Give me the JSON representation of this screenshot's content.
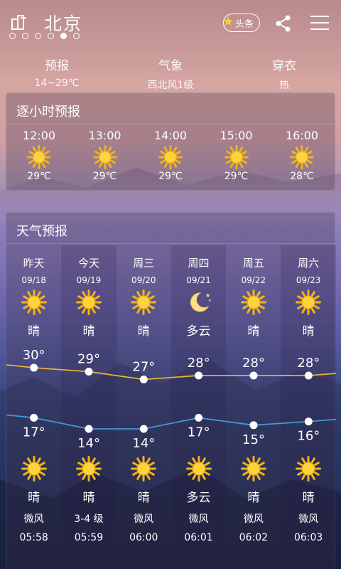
{
  "header": {
    "city": "北京",
    "news_label": "头条",
    "page_dots": 6,
    "active_dot": 4
  },
  "summary": [
    {
      "title": "预报",
      "value": "14~29℃"
    },
    {
      "title": "气象",
      "value": "西北风1级"
    },
    {
      "title": "穿衣",
      "value": "热"
    }
  ],
  "hourly": {
    "title": "逐小时预报",
    "items": [
      {
        "time": "12:00",
        "icon": "sun-icon",
        "temp": "29℃"
      },
      {
        "time": "13:00",
        "icon": "sun-icon",
        "temp": "29℃"
      },
      {
        "time": "14:00",
        "icon": "sun-icon",
        "temp": "29℃"
      },
      {
        "time": "15:00",
        "icon": "sun-icon",
        "temp": "29℃"
      },
      {
        "time": "16:00",
        "icon": "sun-icon",
        "temp": "28℃"
      }
    ]
  },
  "forecast": {
    "title": "天气预报",
    "days": [
      {
        "name": "昨天",
        "date": "09/18",
        "day_icon": "sun-icon",
        "day_cond": "晴",
        "high": 30,
        "low": 17,
        "night_icon": "sun-icon",
        "night_cond": "晴",
        "wind": "微风",
        "sunrise": "05:58"
      },
      {
        "name": "今天",
        "date": "09/19",
        "day_icon": "sun-icon",
        "day_cond": "晴",
        "high": 29,
        "low": 14,
        "night_icon": "sun-icon",
        "night_cond": "晴",
        "wind": "3-4 级",
        "sunrise": "05:59"
      },
      {
        "name": "周三",
        "date": "09/20",
        "day_icon": "sun-icon",
        "day_cond": "晴",
        "high": 27,
        "low": 14,
        "night_icon": "sun-icon",
        "night_cond": "晴",
        "wind": "微风",
        "sunrise": "06:00"
      },
      {
        "name": "周四",
        "date": "09/21",
        "day_icon": "moon-icon",
        "day_cond": "多云",
        "high": 28,
        "low": 17,
        "night_icon": "sun-icon",
        "night_cond": "多云",
        "wind": "微风",
        "sunrise": "06:01"
      },
      {
        "name": "周五",
        "date": "09/22",
        "day_icon": "sun-icon",
        "day_cond": "晴",
        "high": 28,
        "low": 15,
        "night_icon": "sun-icon",
        "night_cond": "晴",
        "wind": "微风",
        "sunrise": "06:02"
      },
      {
        "name": "周六",
        "date": "09/23",
        "day_icon": "sun-icon",
        "day_cond": "晴",
        "high": 28,
        "low": 16,
        "night_icon": "sun-icon",
        "night_cond": "晴",
        "wind": "微风",
        "sunrise": "06:03"
      }
    ],
    "high_line_color": "#e6b23a",
    "low_line_color": "#3f9ad8"
  }
}
